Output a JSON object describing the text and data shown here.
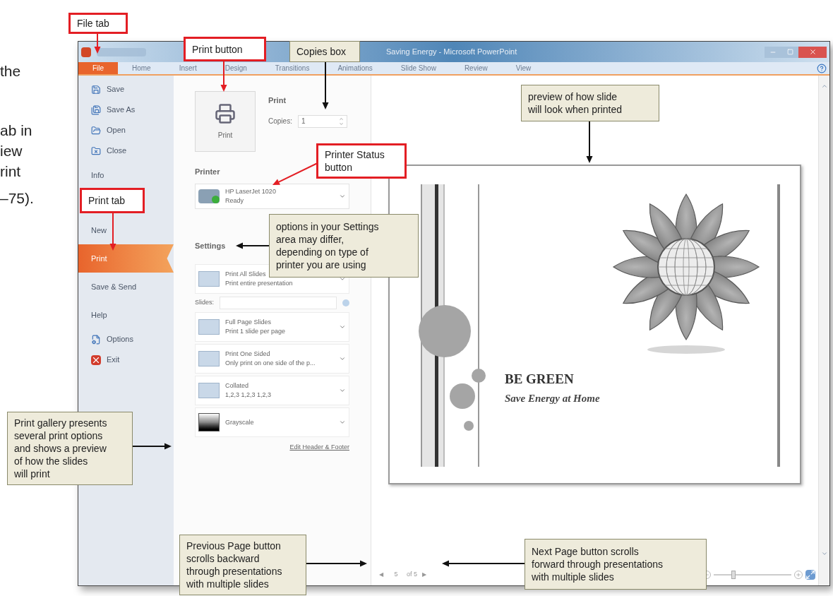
{
  "page_text_fragments": [
    "the",
    "ab in",
    "iew",
    "rint",
    "–75)."
  ],
  "window": {
    "title": "Saving Energy - Microsoft PowerPoint",
    "tabs": [
      {
        "label": "File",
        "selected": true
      },
      {
        "label": "Home",
        "selected": false
      },
      {
        "label": "Insert",
        "selected": false
      },
      {
        "label": "Design",
        "selected": false
      },
      {
        "label": "Transitions",
        "selected": false
      },
      {
        "label": "Animations",
        "selected": false
      },
      {
        "label": "Slide Show",
        "selected": false
      },
      {
        "label": "Review",
        "selected": false
      },
      {
        "label": "View",
        "selected": false
      }
    ]
  },
  "backstage_menu": [
    {
      "label": "Save",
      "kind": "command",
      "selected": false
    },
    {
      "label": "Save As",
      "kind": "command",
      "selected": false
    },
    {
      "label": "Open",
      "kind": "command",
      "selected": false
    },
    {
      "label": "Close",
      "kind": "command",
      "selected": false
    },
    {
      "label": "Info",
      "kind": "tab",
      "selected": false
    },
    {
      "label": "New",
      "kind": "tab",
      "selected": false
    },
    {
      "label": "Print",
      "kind": "tab",
      "selected": true
    },
    {
      "label": "Save & Send",
      "kind": "tab",
      "selected": false
    },
    {
      "label": "Help",
      "kind": "tab",
      "selected": false
    },
    {
      "label": "Options",
      "kind": "command",
      "selected": false
    },
    {
      "label": "Exit",
      "kind": "command",
      "selected": false
    }
  ],
  "print_panel": {
    "print_button": "Print",
    "print_heading": "Print",
    "copies_label": "Copies:",
    "copies_value": "1",
    "printer_heading": "Printer",
    "printer_name": "HP LaserJet 1020",
    "printer_status": "Ready",
    "settings_heading": "Settings",
    "settings": [
      {
        "title": "Print All Slides",
        "subtitle": "Print entire presentation"
      },
      {
        "title": "Full Page Slides",
        "subtitle": "Print 1 slide per page"
      },
      {
        "title": "Print One Sided",
        "subtitle": "Only print on one side of the p..."
      },
      {
        "title": "Collated",
        "subtitle": "1,2,3   1,2,3   1,2,3"
      },
      {
        "title": "Grayscale"
      }
    ],
    "slides_label": "Slides:",
    "edit_link": "Edit Header & Footer"
  },
  "preview": {
    "slide_title": "BE GREEN",
    "slide_subtitle": "Save Energy at Home",
    "previous_page": "◀",
    "page_number": "5",
    "page_total": "of 5",
    "next_page": "▶",
    "zoom": {
      "level": 0.25
    }
  },
  "callouts": [
    {
      "lines": [
        "File tab"
      ],
      "kind": "label"
    },
    {
      "lines": [
        "Print button"
      ],
      "kind": "label"
    },
    {
      "lines": [
        "Copies box"
      ],
      "kind": "note"
    },
    {
      "lines": [
        "preview of how slide",
        "will look when printed"
      ],
      "kind": "note"
    },
    {
      "lines": [
        "Printer Status",
        "button"
      ],
      "kind": "label"
    },
    {
      "lines": [
        "Print tab"
      ],
      "kind": "label"
    },
    {
      "lines": [
        "options in your Settings",
        "area may differ,",
        "depending on type of",
        "printer you are using"
      ],
      "kind": "note"
    },
    {
      "lines": [
        "Print gallery presents",
        "several print options",
        "and shows a preview",
        "of how the slides",
        "will print"
      ],
      "kind": "note"
    },
    {
      "lines": [
        "Previous Page button",
        "scrolls backward",
        "through presentations",
        "with multiple slides"
      ],
      "kind": "note"
    },
    {
      "lines": [
        "Next Page button scrolls",
        "forward through presentations",
        "with multiple slides"
      ],
      "kind": "note"
    }
  ]
}
